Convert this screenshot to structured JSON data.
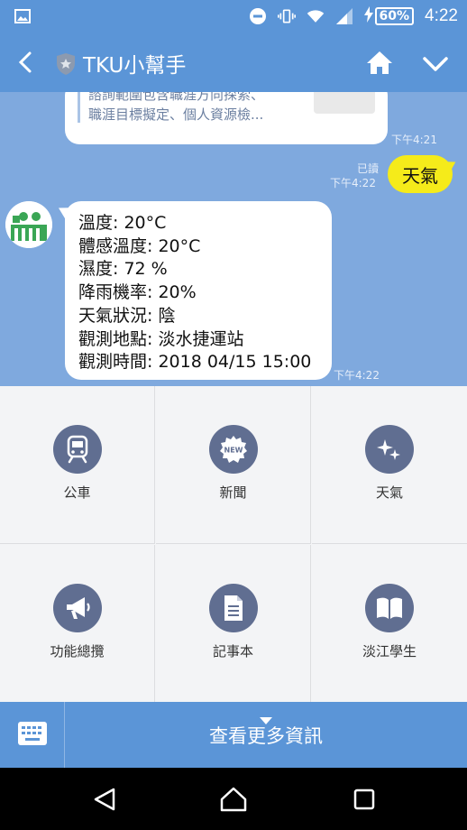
{
  "status_bar": {
    "battery": "60%",
    "time": "4:22",
    "icons": [
      "image-icon",
      "do-not-disturb-icon",
      "vibrate-icon",
      "wifi-icon",
      "signal-icon",
      "charging-icon"
    ]
  },
  "header": {
    "title": "TKU小幫手",
    "icons": [
      "back-icon",
      "shield-icon",
      "home-icon",
      "chevron-down-icon"
    ]
  },
  "chat": {
    "previous_message": {
      "lines": [
        "諮詢範圍包含職涯方向探索、",
        "職涯目標擬定、個人資源檢..."
      ],
      "time": "下午4:21"
    },
    "user_message": {
      "text": "天氣",
      "read_label": "已讀",
      "time": "下午4:22"
    },
    "bot_message": {
      "lines": [
        "溫度: 20°C",
        "體感溫度: 20°C",
        "濕度: 72 %",
        "降雨機率: 20%",
        "天氣狀況: 陰",
        "觀測地點: 淡水捷運站",
        "觀測時間: 2018 04/15 15:00"
      ],
      "time": "下午4:22"
    }
  },
  "menu": {
    "items": [
      {
        "label": "公車",
        "icon": "train-icon"
      },
      {
        "label": "新聞",
        "icon": "new-badge-icon"
      },
      {
        "label": "天氣",
        "icon": "sparkle-icon"
      },
      {
        "label": "功能總攬",
        "icon": "megaphone-icon"
      },
      {
        "label": "記事本",
        "icon": "document-icon"
      },
      {
        "label": "淡江學生",
        "icon": "book-icon"
      }
    ]
  },
  "bottom_bar": {
    "more_label": "查看更多資訊",
    "icons": [
      "keyboard-icon",
      "caret-down-icon"
    ]
  },
  "nav_bar": {
    "icons": [
      "nav-back-icon",
      "nav-home-icon",
      "nav-recents-icon"
    ]
  },
  "colors": {
    "accent": "#5b95d7",
    "chat_background": "#7fa9de",
    "user_bubble": "#f5eb1a",
    "menu_icon": "#606e91"
  }
}
